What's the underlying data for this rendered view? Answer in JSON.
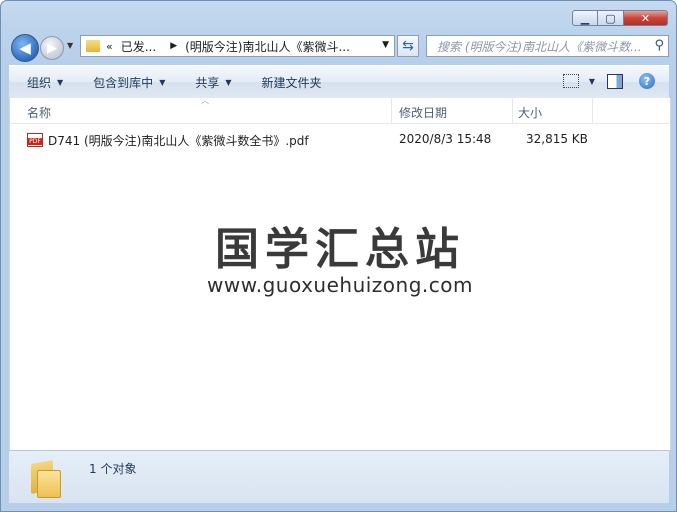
{
  "window": {
    "caption": {
      "minimize": "▁",
      "maximize": "▢",
      "close": "✕"
    }
  },
  "nav": {
    "back_glyph": "◀",
    "forward_glyph": "▶",
    "address": {
      "chevrons": "«",
      "segment1": "已发...",
      "segment2": "(明版今注)南北山人《紫微斗...",
      "separator": "▶"
    },
    "search_placeholder": "搜索 (明版今注)南北山人《紫微斗数..."
  },
  "toolbar": {
    "organize": "组织",
    "include_in_library": "包含到库中",
    "share": "共享",
    "new_folder": "新建文件夹"
  },
  "columns": {
    "name": "名称",
    "modified": "修改日期",
    "size": "大小"
  },
  "files": [
    {
      "icon": "pdf-icon",
      "name": "D741 (明版今注)南北山人《紫微斗数全书》.pdf",
      "modified": "2020/8/3 15:48",
      "size": "32,815 KB"
    }
  ],
  "watermark": {
    "title": "国学汇总站",
    "url": "www.guoxuehuizong.com"
  },
  "details": {
    "status": "1 个对象"
  }
}
